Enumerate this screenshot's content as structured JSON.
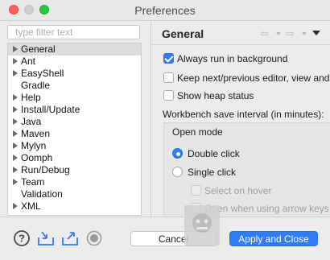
{
  "window": {
    "title": "Preferences"
  },
  "filter": {
    "placeholder": "type filter text"
  },
  "tree": {
    "items": [
      {
        "label": "General",
        "expandable": true,
        "selected": true
      },
      {
        "label": "Ant",
        "expandable": true
      },
      {
        "label": "EasyShell",
        "expandable": true
      },
      {
        "label": "Gradle",
        "expandable": false
      },
      {
        "label": "Help",
        "expandable": true
      },
      {
        "label": "Install/Update",
        "expandable": true
      },
      {
        "label": "Java",
        "expandable": true
      },
      {
        "label": "Maven",
        "expandable": true
      },
      {
        "label": "Mylyn",
        "expandable": true
      },
      {
        "label": "Oomph",
        "expandable": true
      },
      {
        "label": "Run/Debug",
        "expandable": true
      },
      {
        "label": "Team",
        "expandable": true
      },
      {
        "label": "Validation",
        "expandable": false
      },
      {
        "label": "XML",
        "expandable": true
      }
    ]
  },
  "page": {
    "title": "General",
    "options": [
      {
        "label": "Always run in background",
        "checked": true
      },
      {
        "label": "Keep next/previous editor, view and",
        "checked": false
      },
      {
        "label": "Show heap status",
        "checked": false
      }
    ],
    "interval_label": "Workbench save interval (in minutes):",
    "open_mode": {
      "title": "Open mode",
      "radios": [
        {
          "label": "Double click",
          "selected": true
        },
        {
          "label": "Single click",
          "selected": false
        }
      ],
      "sub_options": [
        {
          "label": "Select on hover",
          "enabled": false
        },
        {
          "label": "Open when using arrow keys",
          "enabled": false
        }
      ]
    }
  },
  "buttons": {
    "cancel": "Cancel",
    "apply_close": "Apply and Close"
  },
  "icons": {
    "help": "help-icon",
    "import": "import-icon",
    "export": "export-icon",
    "record": "record-icon"
  },
  "colors": {
    "accent": "#2f7cf6"
  }
}
